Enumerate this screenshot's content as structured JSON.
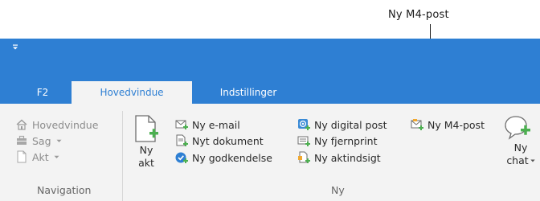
{
  "callout": {
    "label": "Ny M4-post"
  },
  "tabs": [
    {
      "label": "F2",
      "active": false
    },
    {
      "label": "Hovedvindue",
      "active": true
    },
    {
      "label": "Indstillinger",
      "active": false
    }
  ],
  "navigation": {
    "items": [
      {
        "label": "Hovedvindue",
        "icon": "home-icon",
        "dropdown": false
      },
      {
        "label": "Sag",
        "icon": "case-icon",
        "dropdown": true
      },
      {
        "label": "Akt",
        "icon": "document-icon",
        "dropdown": true
      }
    ],
    "group_label": "Navigation"
  },
  "ny": {
    "big_button": {
      "line1": "Ny",
      "line2": "akt"
    },
    "col1": [
      {
        "label": "Ny e-mail",
        "icon": "email-icon"
      },
      {
        "label": "Nyt dokument",
        "icon": "new-document-icon"
      },
      {
        "label": "Ny godkendelse",
        "icon": "approval-icon"
      }
    ],
    "col2": [
      {
        "label": "Ny digital post",
        "icon": "digital-post-icon"
      },
      {
        "label": "Ny fjernprint",
        "icon": "remote-print-icon"
      },
      {
        "label": "Ny aktindsigt",
        "icon": "access-request-icon"
      }
    ],
    "col3": [
      {
        "label": "Ny M4-post",
        "icon": "m4-post-icon"
      }
    ],
    "chat_button": {
      "line1": "Ny",
      "line2": "chat"
    },
    "group_label": "Ny"
  },
  "colors": {
    "accent": "#2e7fd3",
    "ribbon_bg": "#f3f3f3",
    "add_green": "#4caf50"
  }
}
